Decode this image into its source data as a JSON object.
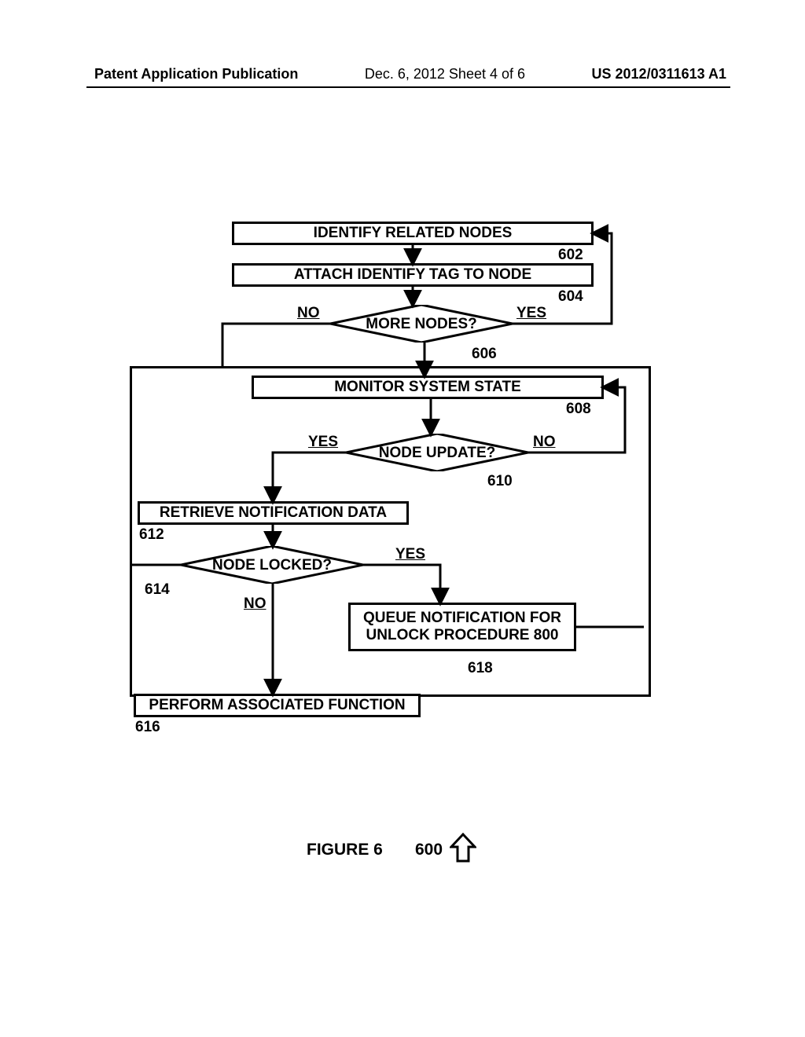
{
  "header": {
    "left": "Patent Application Publication",
    "mid": "Dec. 6, 2012  Sheet 4 of 6",
    "right": "US 2012/0311613 A1"
  },
  "steps": {
    "s602": {
      "text": "IDENTIFY RELATED NODES",
      "ref": "602"
    },
    "s604": {
      "text": "ATTACH IDENTIFY TAG TO NODE",
      "ref": "604"
    },
    "s606": {
      "text": "MORE NODES?",
      "ref": "606"
    },
    "s608": {
      "text": "MONITOR SYSTEM STATE",
      "ref": "608"
    },
    "s610": {
      "text": "NODE UPDATE?",
      "ref": "610"
    },
    "s612": {
      "text": "RETRIEVE NOTIFICATION DATA",
      "ref": "612"
    },
    "s614": {
      "text": "NODE LOCKED?",
      "ref": "614"
    },
    "s616": {
      "text": "PERFORM ASSOCIATED FUNCTION",
      "ref": "616"
    },
    "s618": {
      "text": "QUEUE NOTIFICATION FOR UNLOCK PROCEDURE 800",
      "ref": "618"
    }
  },
  "edges": {
    "e606_no": "NO",
    "e606_yes": "YES",
    "e610_yes": "YES",
    "e610_no": "NO",
    "e614_yes": "YES",
    "e614_no": "NO"
  },
  "caption": {
    "figure": "FIGURE 6",
    "num": "600"
  },
  "chart_data": {
    "type": "flowchart",
    "nodes": [
      {
        "id": "602",
        "label": "IDENTIFY RELATED NODES",
        "shape": "process"
      },
      {
        "id": "604",
        "label": "ATTACH IDENTIFY TAG TO NODE",
        "shape": "process"
      },
      {
        "id": "606",
        "label": "MORE NODES?",
        "shape": "decision"
      },
      {
        "id": "608",
        "label": "MONITOR SYSTEM STATE",
        "shape": "process"
      },
      {
        "id": "610",
        "label": "NODE UPDATE?",
        "shape": "decision"
      },
      {
        "id": "612",
        "label": "RETRIEVE NOTIFICATION DATA",
        "shape": "process"
      },
      {
        "id": "614",
        "label": "NODE LOCKED?",
        "shape": "decision"
      },
      {
        "id": "616",
        "label": "PERFORM ASSOCIATED FUNCTION",
        "shape": "process"
      },
      {
        "id": "618",
        "label": "QUEUE NOTIFICATION FOR UNLOCK PROCEDURE 800",
        "shape": "process"
      }
    ],
    "edges": [
      {
        "from": "602",
        "to": "604"
      },
      {
        "from": "604",
        "to": "606"
      },
      {
        "from": "606",
        "to": "602",
        "label": "YES"
      },
      {
        "from": "606",
        "to": "608",
        "label": "NO"
      },
      {
        "from": "608",
        "to": "610"
      },
      {
        "from": "610",
        "to": "608",
        "label": "NO"
      },
      {
        "from": "610",
        "to": "612",
        "label": "YES"
      },
      {
        "from": "612",
        "to": "614"
      },
      {
        "from": "614",
        "to": "618",
        "label": "YES"
      },
      {
        "from": "614",
        "to": "616",
        "label": "NO"
      },
      {
        "from": "618",
        "to": "608"
      }
    ],
    "figure": "FIGURE 6",
    "figure_ref": "600"
  }
}
